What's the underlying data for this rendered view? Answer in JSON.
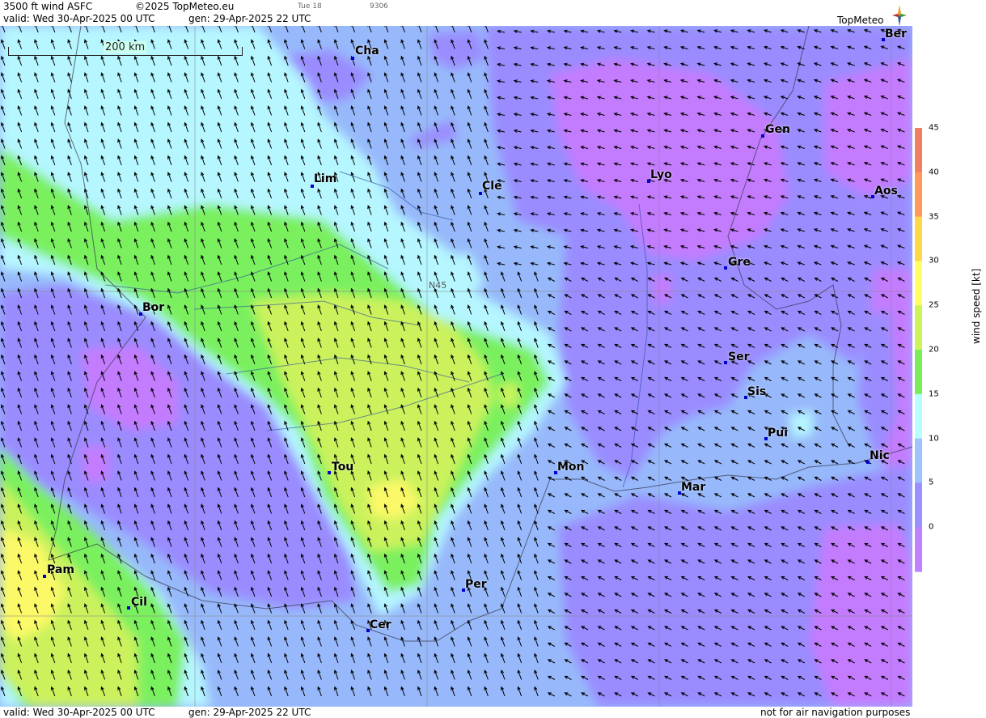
{
  "header": {
    "title": "3500 ft wind ASFC",
    "copyright": "©2025 TopMeteo.eu",
    "valid": "valid:  Wed  30-Apr-2025  00 UTC",
    "gen": "gen: 29-Apr-2025 22 UTC",
    "tiny1": "Tue 18",
    "tiny2": "9306",
    "logo_text": "TopMeteo"
  },
  "footer": {
    "valid": "valid:  Wed  30-Apr-2025  00 UTC",
    "gen": "gen: 29-Apr-2025 22 UTC",
    "note": "not for air navigation purposes"
  },
  "map": {
    "scale_label": "200 km",
    "lat_label": "N45",
    "cities": [
      {
        "name": "Cha"
      },
      {
        "name": "Ber"
      },
      {
        "name": "Gen"
      },
      {
        "name": "Lim"
      },
      {
        "name": "Cle"
      },
      {
        "name": "Lyo"
      },
      {
        "name": "Aos"
      },
      {
        "name": "Gre"
      },
      {
        "name": "Bor"
      },
      {
        "name": "Ser"
      },
      {
        "name": "Sis"
      },
      {
        "name": "Pui"
      },
      {
        "name": "Tou"
      },
      {
        "name": "Mon"
      },
      {
        "name": "Nic"
      },
      {
        "name": "Mar"
      },
      {
        "name": "Pam"
      },
      {
        "name": "Per"
      },
      {
        "name": "Cil"
      },
      {
        "name": "Cer"
      }
    ]
  },
  "legend": {
    "unit": "wind  speed  [kt]",
    "ticks": [
      "45",
      "40",
      "35",
      "30",
      "25",
      "20",
      "15",
      "10",
      "5",
      "0"
    ],
    "colors": [
      "#f08060",
      "#ff9a5a",
      "#ffd84a",
      "#ffff66",
      "#ccf55a",
      "#7aee5a",
      "#b8ffff",
      "#9ec4ff",
      "#9a90ff",
      "#c080ff"
    ]
  },
  "colors": {
    "c0": "#c47cff",
    "c5": "#9a8cff",
    "c10": "#97b9fb",
    "c15": "#b5f6ff",
    "c20": "#7af05e",
    "c25": "#cbf25d",
    "c30": "#fbf968"
  }
}
